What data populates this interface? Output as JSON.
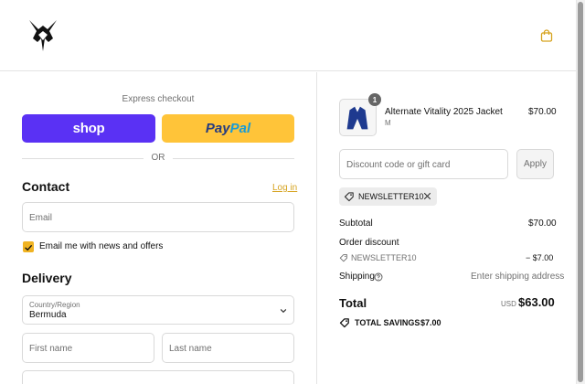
{
  "colors": {
    "accent": "#f0b322",
    "shop_pay": "#5a31f4",
    "paypal": "#ffc439",
    "link": "#d6a31f"
  },
  "header": {
    "logo_icon": "vitality-bee-logo",
    "cart_icon": "shopping-bag-icon"
  },
  "express": {
    "label": "Express checkout",
    "shop_label": "shop",
    "paypal_part1": "Pay",
    "paypal_part2": "Pal",
    "or_label": "OR"
  },
  "contact": {
    "heading": "Contact",
    "login_label": "Log in",
    "email_placeholder": "Email",
    "newsletter_label": "Email me with news and offers",
    "newsletter_checked": true
  },
  "delivery": {
    "heading": "Delivery",
    "country_label": "Country/Region",
    "country_value": "Bermuda",
    "first_name_placeholder": "First name",
    "last_name_placeholder": "Last name"
  },
  "summary": {
    "product": {
      "name": "Alternate Vitality 2025 Jacket",
      "variant": "M",
      "price": "$70.00",
      "quantity": "1"
    },
    "discount_placeholder": "Discount code or gift card",
    "apply_label": "Apply",
    "applied_code": "NEWSLETTER10",
    "subtotal_label": "Subtotal",
    "subtotal_value": "$70.00",
    "order_discount_label": "Order discount",
    "discount_code_label": "NEWSLETTER10",
    "discount_value": "− $7.00",
    "shipping_label": "Shipping",
    "shipping_value": "Enter shipping address",
    "total_label": "Total",
    "currency": "USD",
    "total_value": "$63.00",
    "savings_label": "TOTAL SAVINGS",
    "savings_value": "$7.00"
  }
}
